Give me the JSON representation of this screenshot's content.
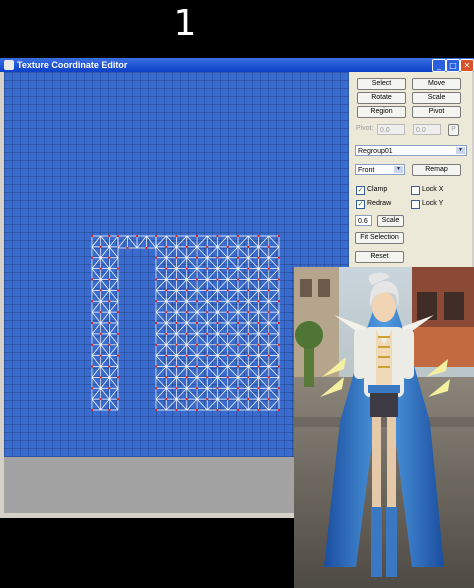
{
  "step_number": "1",
  "window": {
    "title": "Texture Coordinate Editor",
    "minimize_label": "_",
    "maximize_label": "□",
    "close_label": "✕"
  },
  "panel": {
    "select_label": "Select",
    "move_label": "Move",
    "rotate_label": "Rotate",
    "scale_label": "Scale",
    "region_label": "Region",
    "pivot_button_label": "Pivot",
    "pivot_label": "Pivot:",
    "pivot_x": "0.0",
    "pivot_y": "0.0",
    "p_label": "P",
    "group_value": "Regroup01",
    "view_value": "Front",
    "remap_label": "Remap",
    "clamp_label": "Clamp",
    "clamp_checked": true,
    "lockx_label": "Lock X",
    "lockx_checked": false,
    "redraw_label": "Redraw",
    "redraw_checked": true,
    "locky_label": "Lock Y",
    "locky_checked": false,
    "scale_value": "0.6",
    "scale_button_label": "Scale",
    "fit_selection_label": "Fit Selection",
    "reset_label": "Reset"
  },
  "colors": {
    "canvas_blue": "#3a6ccf",
    "grid_line": "#1f3f85",
    "mesh_edge": "#ffffff",
    "vertex": "#e02020",
    "panel_bg": "#ece9d8"
  }
}
